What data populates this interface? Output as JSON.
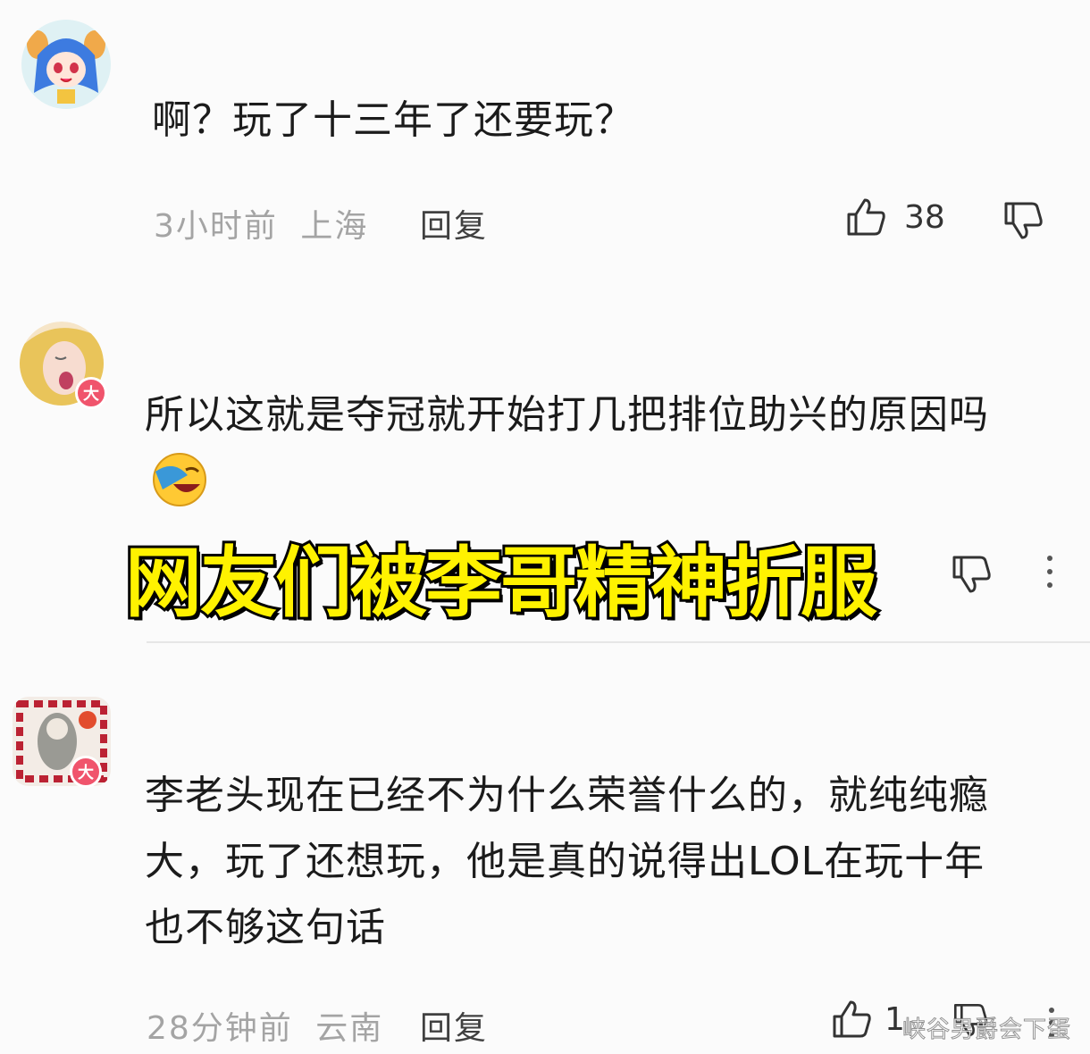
{
  "comments": [
    {
      "text": "啊？玩了十三年了还要玩？",
      "time": "3小时前",
      "location": "上海",
      "reply_label": "回复",
      "likes": "38"
    },
    {
      "text": "所以这就是夺冠就开始打几把排位助兴的原因吗",
      "badge": "大"
    },
    {
      "text_lines": [
        "李老头现在已经不为什么荣誉什么的，就纯纯瘾",
        "大，玩了还想玩，他是真的说得出LOL在玩十年",
        "也不够这句话"
      ],
      "badge": "大",
      "time": "28分钟前",
      "location": "云南",
      "reply_label": "回复",
      "likes": "1"
    }
  ],
  "overlay_caption": "网友们被李哥精神折服",
  "watermark": "峡谷男爵会下蛋",
  "colors": {
    "caption_fill": "#fff200",
    "badge": "#f0546c"
  }
}
